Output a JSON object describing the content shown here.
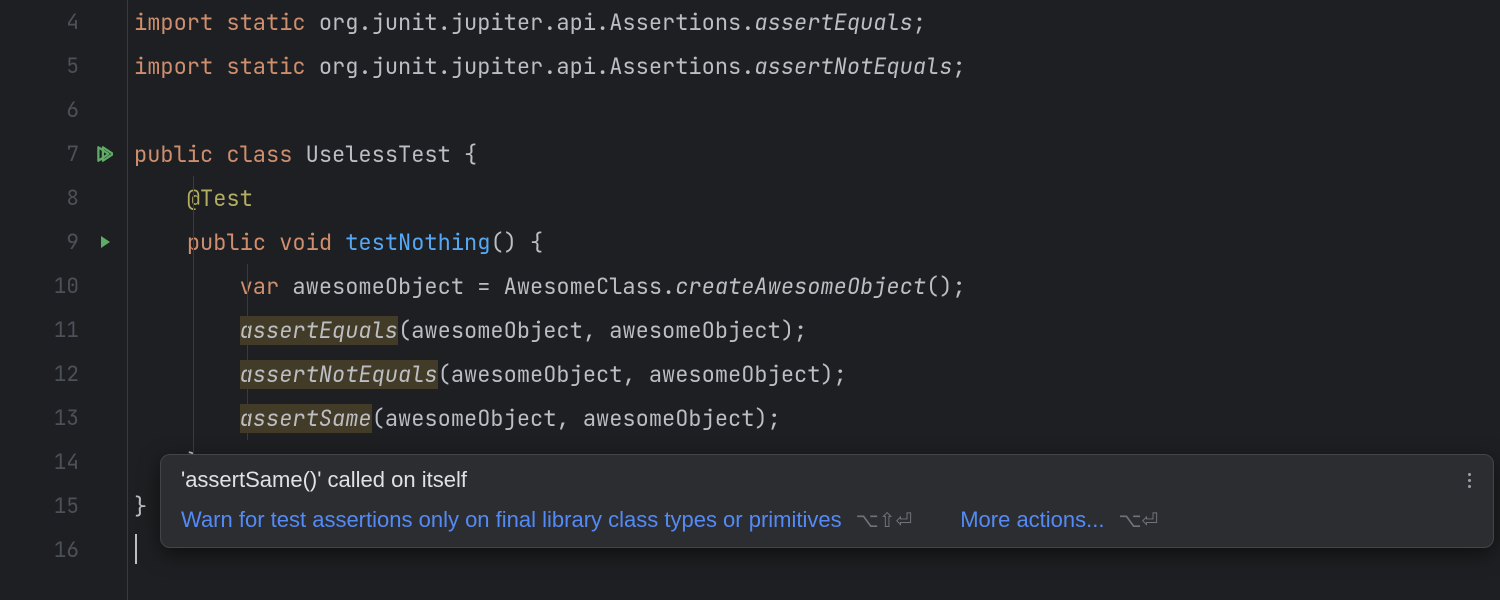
{
  "gutter": {
    "lines": [
      "4",
      "5",
      "6",
      "7",
      "8",
      "9",
      "10",
      "11",
      "12",
      "13",
      "14",
      "15",
      "16"
    ]
  },
  "code": {
    "l4": {
      "import": "import",
      "static": "static",
      "pkg": "org.junit.jupiter.api.Assertions.",
      "method": "assertEquals",
      "semi": ";"
    },
    "l5": {
      "import": "import",
      "static": "static",
      "pkg": "org.junit.jupiter.api.Assertions.",
      "method": "assertNotEquals",
      "semi": ";"
    },
    "l7": {
      "public": "public",
      "class": "class",
      "name": "UselessTest",
      "brace": " {"
    },
    "l8": {
      "ann": "@Test"
    },
    "l9": {
      "public": "public",
      "void": "void",
      "name": "testNothing",
      "rest": "() {"
    },
    "l10": {
      "var": "var",
      "ident": " awesomeObject = AwesomeClass.",
      "method": "createAwesomeObject",
      "rest": "();"
    },
    "l11": {
      "method": "assertEquals",
      "rest": "(awesomeObject, awesomeObject);"
    },
    "l12": {
      "method": "assertNotEquals",
      "rest": "(awesomeObject, awesomeObject);"
    },
    "l13": {
      "method": "assertSame",
      "rest": "(awesomeObject, awesomeObject);"
    },
    "l14": {
      "brace": "}"
    },
    "l15": {
      "brace": "}"
    }
  },
  "popup": {
    "title": "'assertSame()' called on itself",
    "action1": "Warn for test assertions only on final library class types or primitives",
    "shortcut1": "⌥⇧⏎",
    "action2": "More actions...",
    "shortcut2": "⌥⏎"
  }
}
